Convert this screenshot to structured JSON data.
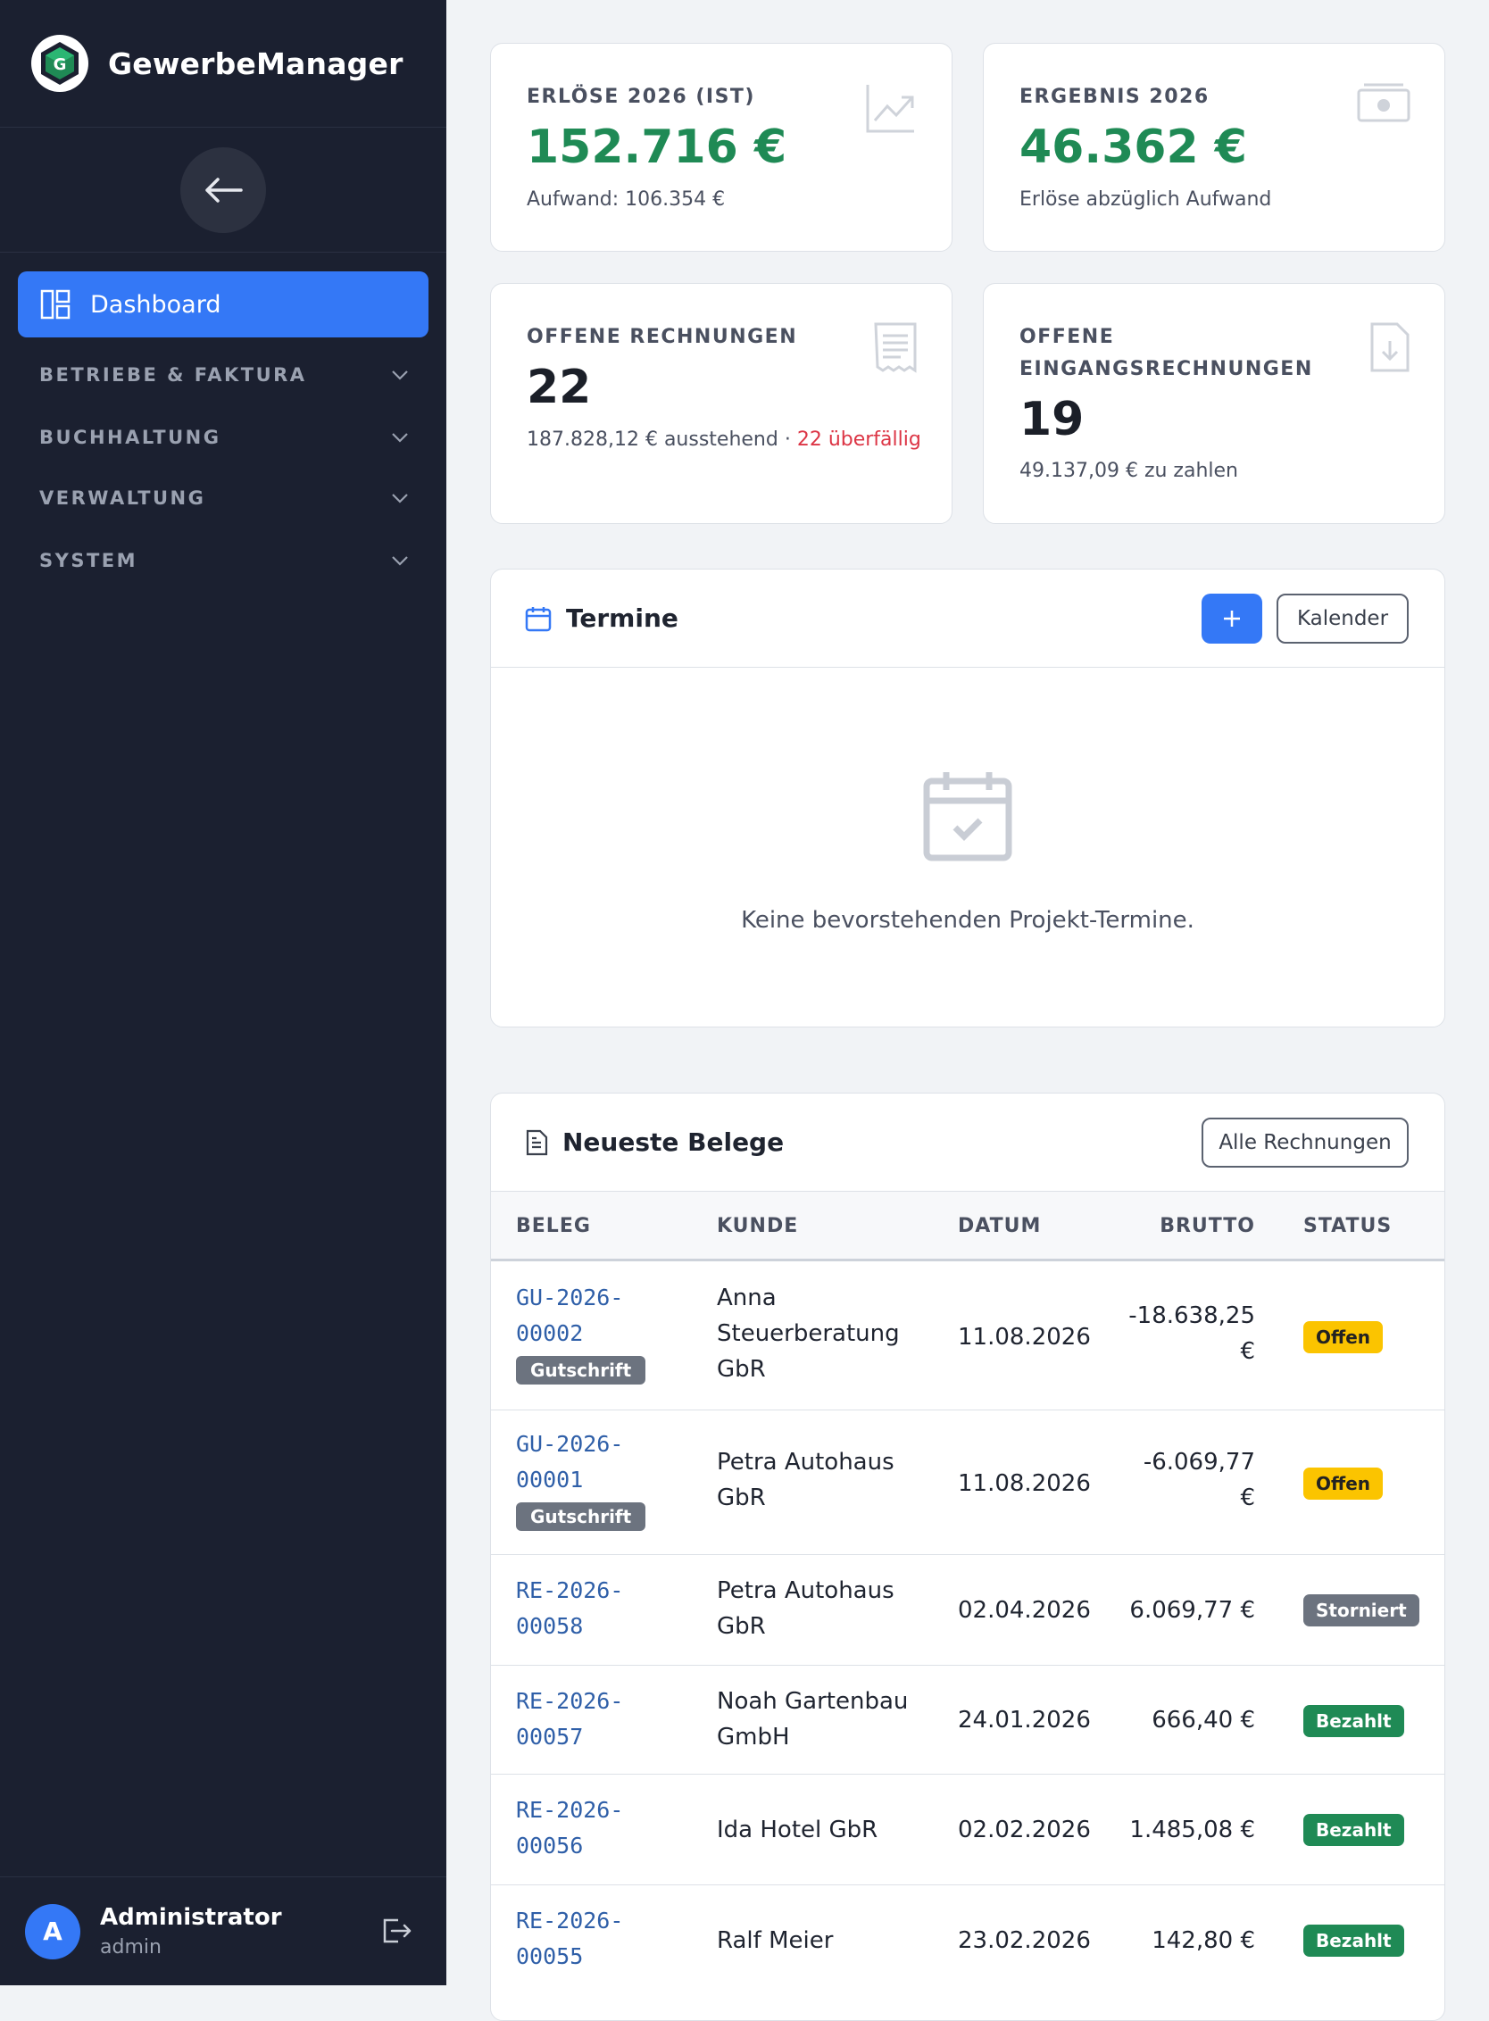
{
  "app": {
    "title": "GewerbeManager"
  },
  "nav": {
    "active_label": "Dashboard",
    "groups": [
      "BETRIEBE & FAKTURA",
      "BUCHHALTUNG",
      "VERWALTUNG",
      "SYSTEM"
    ]
  },
  "user": {
    "initial": "A",
    "name": "Administrator",
    "role": "admin"
  },
  "stats": {
    "revenue": {
      "label": "ERLÖSE 2026 (IST)",
      "value": "152.716 €",
      "sub": "Aufwand: 106.354 €"
    },
    "result": {
      "label": "ERGEBNIS 2026",
      "value": "46.362 €",
      "sub": "Erlöse abzüglich Aufwand"
    },
    "open_invoices": {
      "label": "OFFENE RECHNUNGEN",
      "value": "22",
      "sub": "187.828,12 € ausstehend · ",
      "sub_overdue": "22 überfällig"
    },
    "open_incoming": {
      "label_line1": "OFFENE",
      "label_line2": "EINGANGSRECHNUNGEN",
      "value": "19",
      "sub": "49.137,09 € zu zahlen"
    }
  },
  "termine": {
    "title": "Termine",
    "add_label": "+",
    "calendar_label": "Kalender",
    "empty_text": "Keine bevorstehenden Projekt-Termine."
  },
  "belege": {
    "title": "Neueste Belege",
    "all_label": "Alle Rechnungen",
    "columns": [
      "BELEG",
      "KUNDE",
      "DATUM",
      "BRUTTO",
      "STATUS"
    ],
    "rows": [
      {
        "nr1": "GU-2026-",
        "nr2": "00002",
        "tag": "Gutschrift",
        "kunde": [
          "Anna",
          "Steuerberatung",
          "GbR"
        ],
        "datum": "11.08.2026",
        "brutto": [
          "-18.638,25",
          "€"
        ],
        "status": "Offen"
      },
      {
        "nr1": "GU-2026-",
        "nr2": "00001",
        "tag": "Gutschrift",
        "kunde": [
          "Petra Autohaus",
          "GbR"
        ],
        "datum": "11.08.2026",
        "brutto": [
          "-6.069,77",
          "€"
        ],
        "status": "Offen"
      },
      {
        "nr1": "RE-2026-",
        "nr2": "00058",
        "kunde": [
          "Petra Autohaus",
          "GbR"
        ],
        "datum": "02.04.2026",
        "brutto": [
          "6.069,77 €"
        ],
        "status": "Storniert"
      },
      {
        "nr1": "RE-2026-",
        "nr2": "00057",
        "kunde": [
          "Noah Gartenbau",
          "GmbH"
        ],
        "datum": "24.01.2026",
        "brutto": [
          "666,40 €"
        ],
        "status": "Bezahlt"
      },
      {
        "nr1": "RE-2026-",
        "nr2": "00056",
        "kunde": [
          "Ida Hotel GbR"
        ],
        "datum": "02.02.2026",
        "brutto": [
          "1.485,08 €"
        ],
        "status": "Bezahlt"
      },
      {
        "nr1": "RE-2026-",
        "nr2": "00055",
        "kunde": [
          "Ralf Meier"
        ],
        "datum": "23.02.2026",
        "brutto": [
          "142,80 €"
        ],
        "status": "Bezahlt"
      }
    ]
  }
}
